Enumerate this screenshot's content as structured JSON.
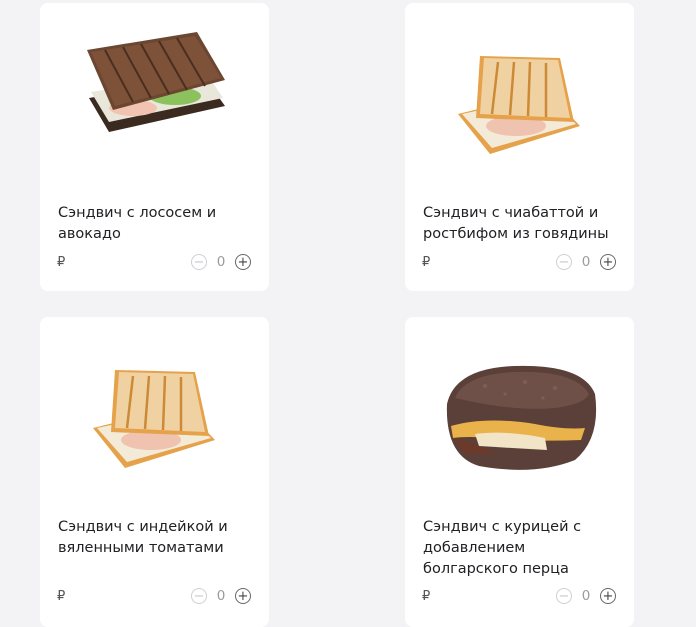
{
  "products": [
    {
      "title": "Сэндвич с лососем и авокадо",
      "price_symbol": "₽",
      "quantity": "0",
      "minus_label": "−",
      "plus_label": "+"
    },
    {
      "title": "Сэндвич с чиабаттой и ростбифом из говядины",
      "price_symbol": "₽",
      "quantity": "0",
      "minus_label": "−",
      "plus_label": "+"
    },
    {
      "title": "Сэндвич с индейкой и вяленными томатами",
      "price_symbol": "₽",
      "quantity": "0",
      "minus_label": "−",
      "plus_label": "+"
    },
    {
      "title": "Сэндвич с курицей с добавлением болгарского перца",
      "price_symbol": "₽",
      "quantity": "0",
      "minus_label": "−",
      "plus_label": "+"
    }
  ],
  "colors": {
    "background": "#f3f3f5",
    "card": "#ffffff",
    "text": "#202124",
    "muted": "#9a9a9f"
  }
}
